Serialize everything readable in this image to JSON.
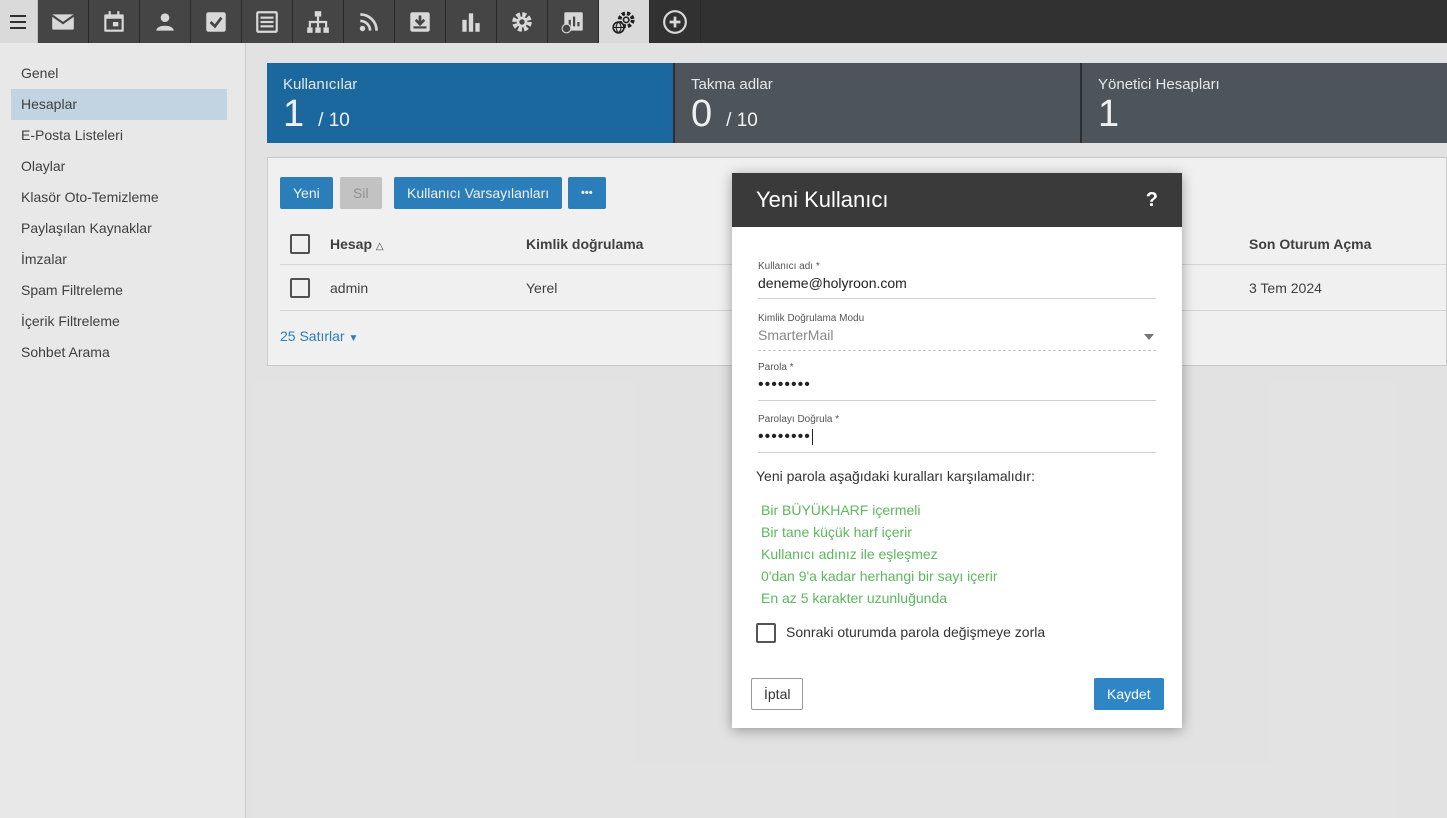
{
  "topbar": {
    "icons": [
      "menu-icon",
      "mail-icon",
      "calendar-icon",
      "contacts-icon",
      "tasks-icon",
      "notes-icon",
      "sitemap-icon",
      "rss-icon",
      "archive-icon",
      "reports-icon",
      "settings-icon",
      "domain-reports-icon",
      "domain-settings-icon",
      "add-icon"
    ]
  },
  "sidebar": {
    "items": [
      "Genel",
      "Hesaplar",
      "E-Posta Listeleri",
      "Olaylar",
      "Klasör Oto-Temizleme",
      "Paylaşılan Kaynaklar",
      "İmzalar",
      "Spam Filtreleme",
      "İçerik Filtreleme",
      "Sohbet Arama"
    ],
    "active_index": 1
  },
  "cards": {
    "users": {
      "title": "Kullanıcılar",
      "value": "1",
      "max": "/ 10"
    },
    "aliases": {
      "title": "Takma adlar",
      "value": "0",
      "max": "/ 10"
    },
    "admins": {
      "title": "Yönetici Hesapları",
      "value": "1"
    }
  },
  "toolbar": {
    "new_label": "Yeni",
    "delete_label": "Sil",
    "defaults_label": "Kullanıcı Varsayılanları",
    "more_label": "•••"
  },
  "table": {
    "headers": {
      "account": "Hesap",
      "auth": "Kimlik doğrulama",
      "last_login": "Son Oturum Açma"
    },
    "rows": [
      {
        "account": "admin",
        "auth": "Yerel",
        "last_login": "3 Tem 2024"
      }
    ],
    "rows_per_page": "25 Satırlar"
  },
  "modal": {
    "title": "Yeni Kullanıcı",
    "help": "?",
    "username_label": "Kullanıcı adı *",
    "username_value": "deneme@holyroon.com",
    "auth_mode_label": "Kimlik Doğrulama Modu",
    "auth_mode_value": "SmarterMail",
    "password_label": "Parola *",
    "password_value": "••••••••",
    "confirm_label": "Parolayı Doğrula *",
    "confirm_value": "••••••••",
    "rules_heading": "Yeni parola aşağıdaki kuralları karşılamalıdır:",
    "rules": [
      "Bir BÜYÜKHARF içermeli",
      "Bir tane küçük harf içerir",
      "Kullanıcı adınız ile eşleşmez",
      "0'dan 9'a kadar herhangi bir sayı içerir",
      "En az 5 karakter uzunluğunda"
    ],
    "force_change_label": "Sonraki oturumda parola değişmeye zorla",
    "cancel_label": "İptal",
    "save_label": "Kaydet"
  },
  "colors": {
    "primary": "#2f86c6",
    "rule_ok": "#5cb85c",
    "topbar": "#353535",
    "card_active": "#1c6fa8",
    "card": "#525b61"
  }
}
